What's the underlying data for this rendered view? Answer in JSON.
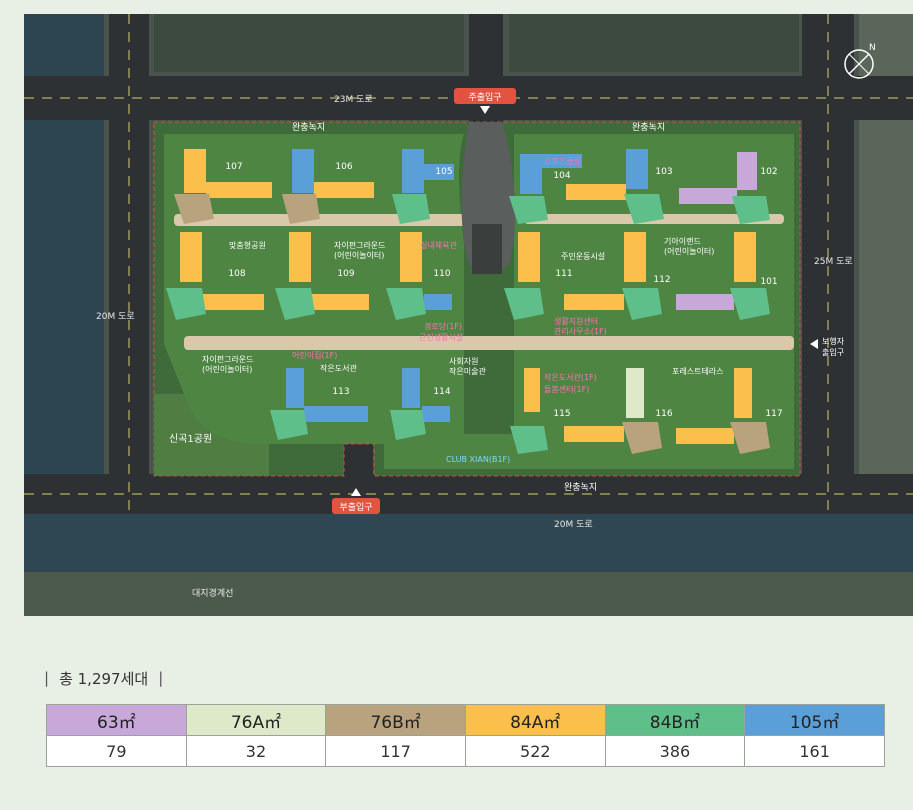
{
  "map": {
    "roads": {
      "north": "23M 도로",
      "east": "25M 도로",
      "west": "20M 도로",
      "south": "20M 도로",
      "canal": "대지경계선"
    },
    "entrances": {
      "main": "주출입구",
      "sub": "부출입구",
      "pedestrian_line1": "보행자",
      "pedestrian_line2": "출입구"
    },
    "green_buffers": [
      "완충녹지",
      "완충녹지",
      "완충녹지"
    ],
    "park": "신곡1공원",
    "buildings": [
      "107",
      "106",
      "105",
      "104",
      "103",
      "102",
      "108",
      "109",
      "110",
      "111",
      "112",
      "101",
      "113",
      "114",
      "115",
      "116",
      "117"
    ],
    "facilities": {
      "f1": "맞춤형공원",
      "f2": "주민운동시설",
      "f3": "스포츠클럽",
      "f4": "실내체육관",
      "f5": "경로당(1F)",
      "f6": "생활지원센터",
      "f7": "관리사무소(1F)",
      "f8": "작은도서관(1F)",
      "f9": "근린생활시설",
      "f10": "기아이랜드",
      "f11": "(어린이놀이터)",
      "f12": "자이펀그라운드",
      "f13": "(어린이놀이터)",
      "f14": "자이펀그라운드",
      "f15": "(어린이놀이터)",
      "f16": "어린이집(1F)",
      "f17": "작은도서관",
      "f18": "돌봄센터(1F)",
      "f19": "사회자원",
      "f20": "작은미술관",
      "f21": "포레스트테라스",
      "f22": "CLUB XIAN(B1F)"
    }
  },
  "summary": {
    "text": "총 1,297세대"
  },
  "types": {
    "headers": [
      "63㎡",
      "76A㎡",
      "76B㎡",
      "84A㎡",
      "84B㎡",
      "105㎡"
    ],
    "counts": [
      "79",
      "32",
      "117",
      "522",
      "386",
      "161"
    ],
    "colors": [
      "#c8a7d9",
      "#dde9c9",
      "#b8a37e",
      "#fbbf4c",
      "#5fbf8b",
      "#5b9fd9"
    ]
  }
}
